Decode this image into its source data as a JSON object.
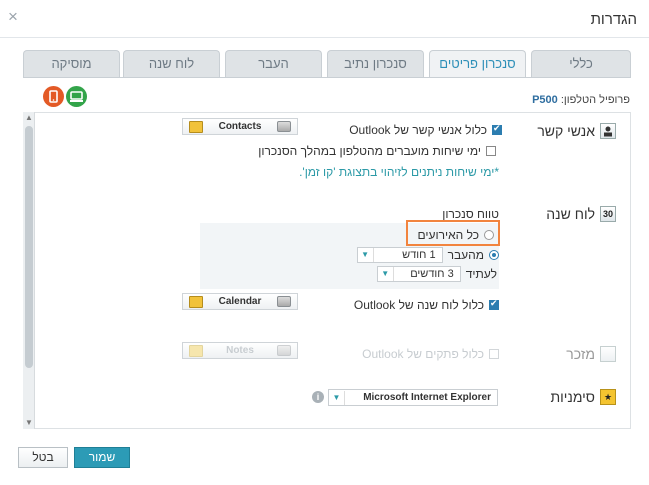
{
  "window": {
    "title": "הגדרות",
    "close_symbol": "×"
  },
  "tabs": [
    {
      "label": "כללי",
      "active": false
    },
    {
      "label": "סנכרון פריטים",
      "active": true
    },
    {
      "label": "סנכרון נתיב",
      "active": false
    },
    {
      "label": "העבר",
      "active": false
    },
    {
      "label": "לוח שנה",
      "active": false
    },
    {
      "label": "מוסיקה",
      "active": false
    }
  ],
  "phone_profile": {
    "label": "פרופיל הטלפון:",
    "value": "P500"
  },
  "contacts": {
    "section_label": "אנשי קשר",
    "sync_label": "כלול אנשי קשר של Outlook",
    "sync_checked": true,
    "folder": "Contacts",
    "birthdays_label": "ימי שיחות מועברים מהטלפון במהלך הסנכרון",
    "birthdays_checked": false,
    "note": "*ימי שיחות ניתנים לזיהוי בתצוגת 'קו זמן'."
  },
  "calendar": {
    "section_label": "לוח שנה",
    "icon_text": "30",
    "range_label": "טווח סנכרון",
    "all_events_label": "כל האירועים",
    "all_events_selected": false,
    "past_label": "מהעבר",
    "past_selected": true,
    "past_value": "1 חודש",
    "future_label": "לעתיד",
    "future_value": "3 חודשים",
    "sync_label": "כלול לוח שנה של Outlook",
    "sync_checked": true,
    "folder": "Calendar"
  },
  "notes": {
    "section_label": "מזכר",
    "sync_label": "כלול פתקים של Outlook",
    "sync_checked": false,
    "folder": "Notes"
  },
  "bookmarks": {
    "section_label": "סימניות",
    "browser": "Microsoft Internet Explorer",
    "info_symbol": "i"
  },
  "buttons": {
    "save": "שמור",
    "cancel": "בטל"
  },
  "colors": {
    "accent": "#2c9bb6",
    "highlight": "#f2843e",
    "note": "#2c9aa7"
  }
}
